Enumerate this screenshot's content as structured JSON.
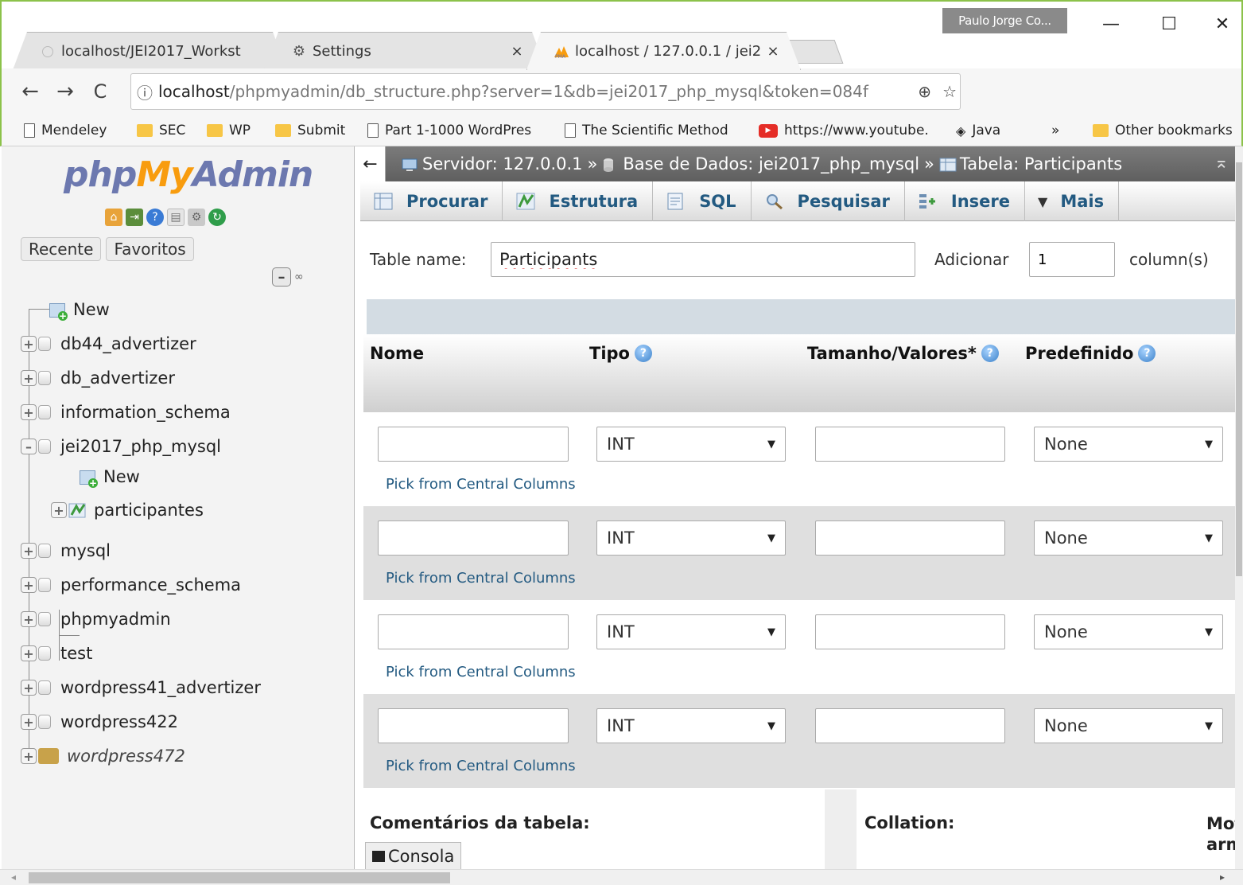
{
  "browser": {
    "profile": "Paulo Jorge Co...",
    "tabs": [
      {
        "title": "localhost/JEI2017_Workst",
        "close": "×"
      },
      {
        "title": "Settings",
        "close": "×"
      },
      {
        "title": "localhost / 127.0.0.1 / jei2",
        "close": "×"
      }
    ],
    "url_host": "localhost",
    "url_path": "/phpmyadmin/db_structure.php?server=1&db=jei2017_php_mysql&token=084f",
    "bookmarks": [
      {
        "label": "Mendeley",
        "icon": "page"
      },
      {
        "label": "SEC",
        "icon": "folder"
      },
      {
        "label": "WP",
        "icon": "folder"
      },
      {
        "label": "Submit",
        "icon": "folder"
      },
      {
        "label": "Part 1-1000 WordPres",
        "icon": "page"
      },
      {
        "label": "The Scientific Method",
        "icon": "page"
      },
      {
        "label": "https://www.youtube.",
        "icon": "youtube"
      },
      {
        "label": "Java",
        "icon": "java"
      },
      {
        "label": "»",
        "icon": "none"
      },
      {
        "label": "Other bookmarks",
        "icon": "folder"
      }
    ]
  },
  "nav": {
    "logo_php": "php",
    "logo_my": "My",
    "logo_admin": "Admin",
    "tab_recent": "Recente",
    "tab_favorites": "Favoritos",
    "tree": [
      {
        "label": "New",
        "level": 0,
        "kind": "new"
      },
      {
        "label": "db44_advertizer",
        "level": 0,
        "kind": "db"
      },
      {
        "label": "db_advertizer",
        "level": 0,
        "kind": "db"
      },
      {
        "label": "information_schema",
        "level": 0,
        "kind": "db"
      },
      {
        "label": "jei2017_php_mysql",
        "level": 0,
        "kind": "db-open"
      },
      {
        "label": "New",
        "level": 1,
        "kind": "new"
      },
      {
        "label": "participantes",
        "level": 1,
        "kind": "table"
      },
      {
        "label": "mysql",
        "level": 0,
        "kind": "db"
      },
      {
        "label": "performance_schema",
        "level": 0,
        "kind": "db"
      },
      {
        "label": "phpmyadmin",
        "level": 0,
        "kind": "db"
      },
      {
        "label": "test",
        "level": 0,
        "kind": "db"
      },
      {
        "label": "wordpress41_advertizer",
        "level": 0,
        "kind": "db"
      },
      {
        "label": "wordpress422",
        "level": 0,
        "kind": "db"
      },
      {
        "label": "wordpress472",
        "level": 0,
        "kind": "db-italic"
      }
    ]
  },
  "main": {
    "breadcrumb": {
      "server": "Servidor: 127.0.0.1",
      "sep": "»",
      "database": "Base de Dados: jei2017_php_mysql",
      "table": "Tabela: Participants"
    },
    "menu": [
      "Procurar",
      "Estrutura",
      "SQL",
      "Pesquisar",
      "Insere",
      "Mais"
    ],
    "table_name_label": "Table name:",
    "table_name_value": "Participants",
    "add_label": "Adicionar",
    "add_value": "1",
    "columns_label": "column(s)",
    "headers": {
      "name": "Nome",
      "type": "Tipo",
      "length": "Tamanho/Valores*",
      "default": "Predefinido"
    },
    "rows": [
      {
        "type": "INT",
        "default": "None",
        "pick": "Pick from Central Columns"
      },
      {
        "type": "INT",
        "default": "None",
        "pick": "Pick from Central Columns"
      },
      {
        "type": "INT",
        "default": "None",
        "pick": "Pick from Central Columns"
      },
      {
        "type": "INT",
        "default": "None",
        "pick": "Pick from Central Columns"
      }
    ],
    "comments_label": "Comentários da tabela:",
    "collation_label": "Collation:",
    "engine_label": "Mot arm",
    "console_label": "Consola"
  }
}
